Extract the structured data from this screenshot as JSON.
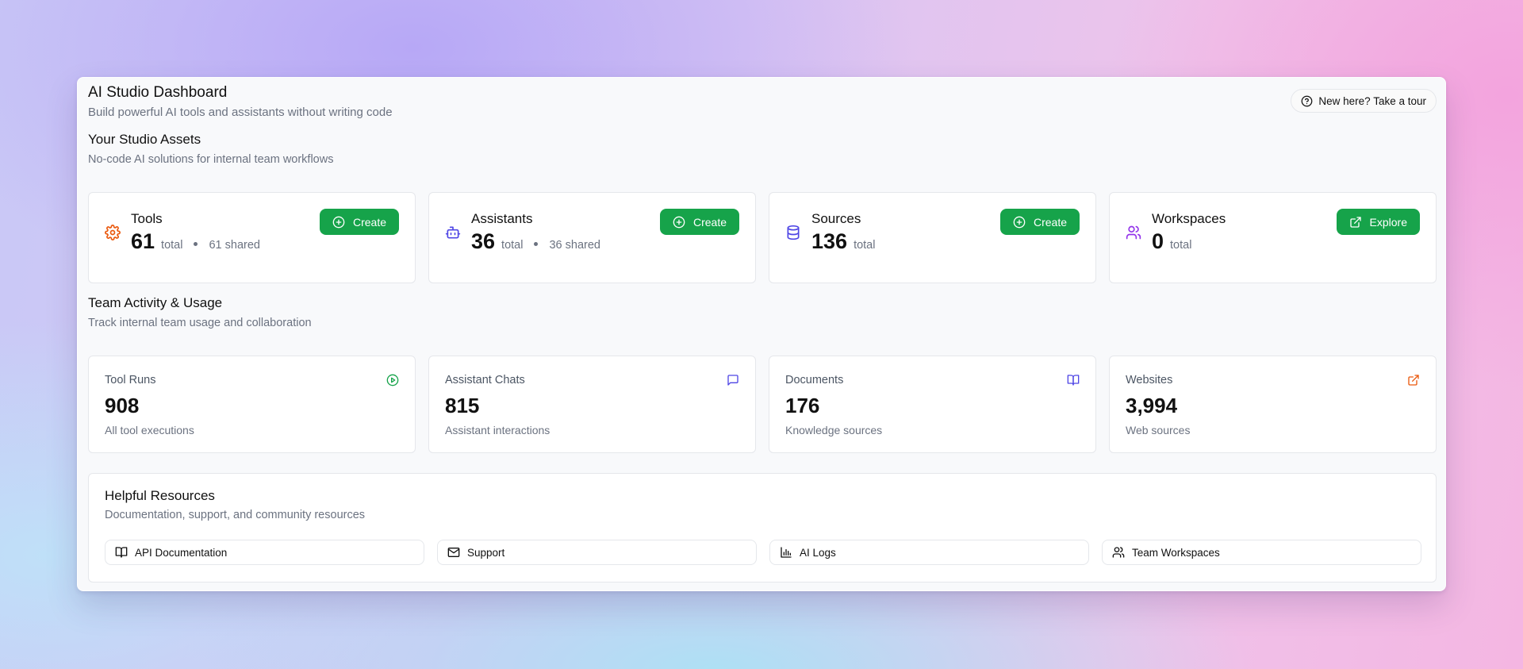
{
  "header": {
    "title": "AI Studio Dashboard",
    "subtitle": "Build powerful AI tools and assistants without writing code",
    "tour_label": "New here? Take a tour"
  },
  "assets_section": {
    "title": "Your Studio Assets",
    "subtitle": "No-code AI solutions for internal team workflows",
    "cards": [
      {
        "name": "Tools",
        "count": "61",
        "total_label": "total",
        "shared_label": "61 shared",
        "button": "Create",
        "icon": "gear-icon",
        "icon_color": "#ea580c"
      },
      {
        "name": "Assistants",
        "count": "36",
        "total_label": "total",
        "shared_label": "36 shared",
        "button": "Create",
        "icon": "bot-icon",
        "icon_color": "#4f46e5"
      },
      {
        "name": "Sources",
        "count": "136",
        "total_label": "total",
        "button": "Create",
        "icon": "database-icon",
        "icon_color": "#4f46e5"
      },
      {
        "name": "Workspaces",
        "count": "0",
        "total_label": "total",
        "button": "Explore",
        "icon": "users-icon",
        "icon_color": "#9333ea"
      }
    ]
  },
  "activity_section": {
    "title": "Team Activity & Usage",
    "subtitle": "Track internal team usage and collaboration",
    "cards": [
      {
        "label": "Tool Runs",
        "value": "908",
        "desc": "All tool executions",
        "icon": "play-circle-icon",
        "icon_color": "#16a34a"
      },
      {
        "label": "Assistant Chats",
        "value": "815",
        "desc": "Assistant interactions",
        "icon": "message-square-icon",
        "icon_color": "#4f46e5"
      },
      {
        "label": "Documents",
        "value": "176",
        "desc": "Knowledge sources",
        "icon": "book-open-icon",
        "icon_color": "#4f46e5"
      },
      {
        "label": "Websites",
        "value": "3,994",
        "desc": "Web sources",
        "icon": "external-link-icon",
        "icon_color": "#ea580c"
      }
    ]
  },
  "resources": {
    "title": "Helpful Resources",
    "subtitle": "Documentation, support, and community resources",
    "links": [
      {
        "label": "API Documentation",
        "icon": "book-open-icon"
      },
      {
        "label": "Support",
        "icon": "mail-icon"
      },
      {
        "label": "AI Logs",
        "icon": "bar-chart-icon"
      },
      {
        "label": "Team Workspaces",
        "icon": "users-icon"
      }
    ]
  },
  "colors": {
    "accent_green": "#16a34a",
    "muted_text": "#6b7280",
    "border": "#e5e7eb"
  }
}
